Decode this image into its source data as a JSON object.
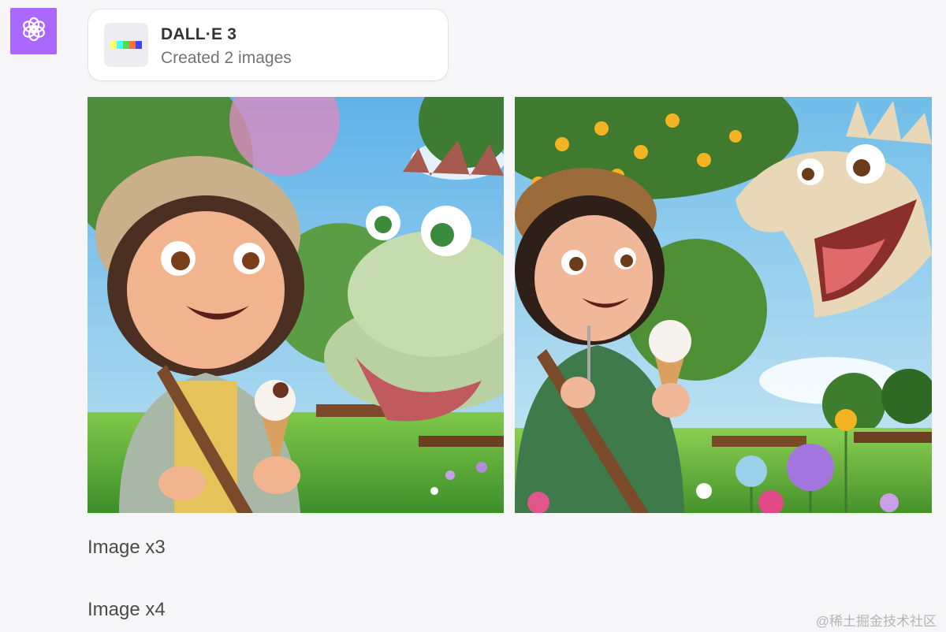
{
  "assistant": {
    "avatar_icon": "openai-logo-icon",
    "avatar_color": "#ab68ff"
  },
  "tool_card": {
    "icon": "dalle-color-bar-icon",
    "title": "DALL·E 3",
    "subtitle": "Created 2 images"
  },
  "images": [
    {
      "icon": "generated-image-girl-dinosaur-icecream-1"
    },
    {
      "icon": "generated-image-girl-dinosaur-icecream-2"
    }
  ],
  "messages": [
    {
      "text": "Image x3"
    },
    {
      "text": "Image x4"
    }
  ],
  "watermark": "@稀土掘金技术社区"
}
